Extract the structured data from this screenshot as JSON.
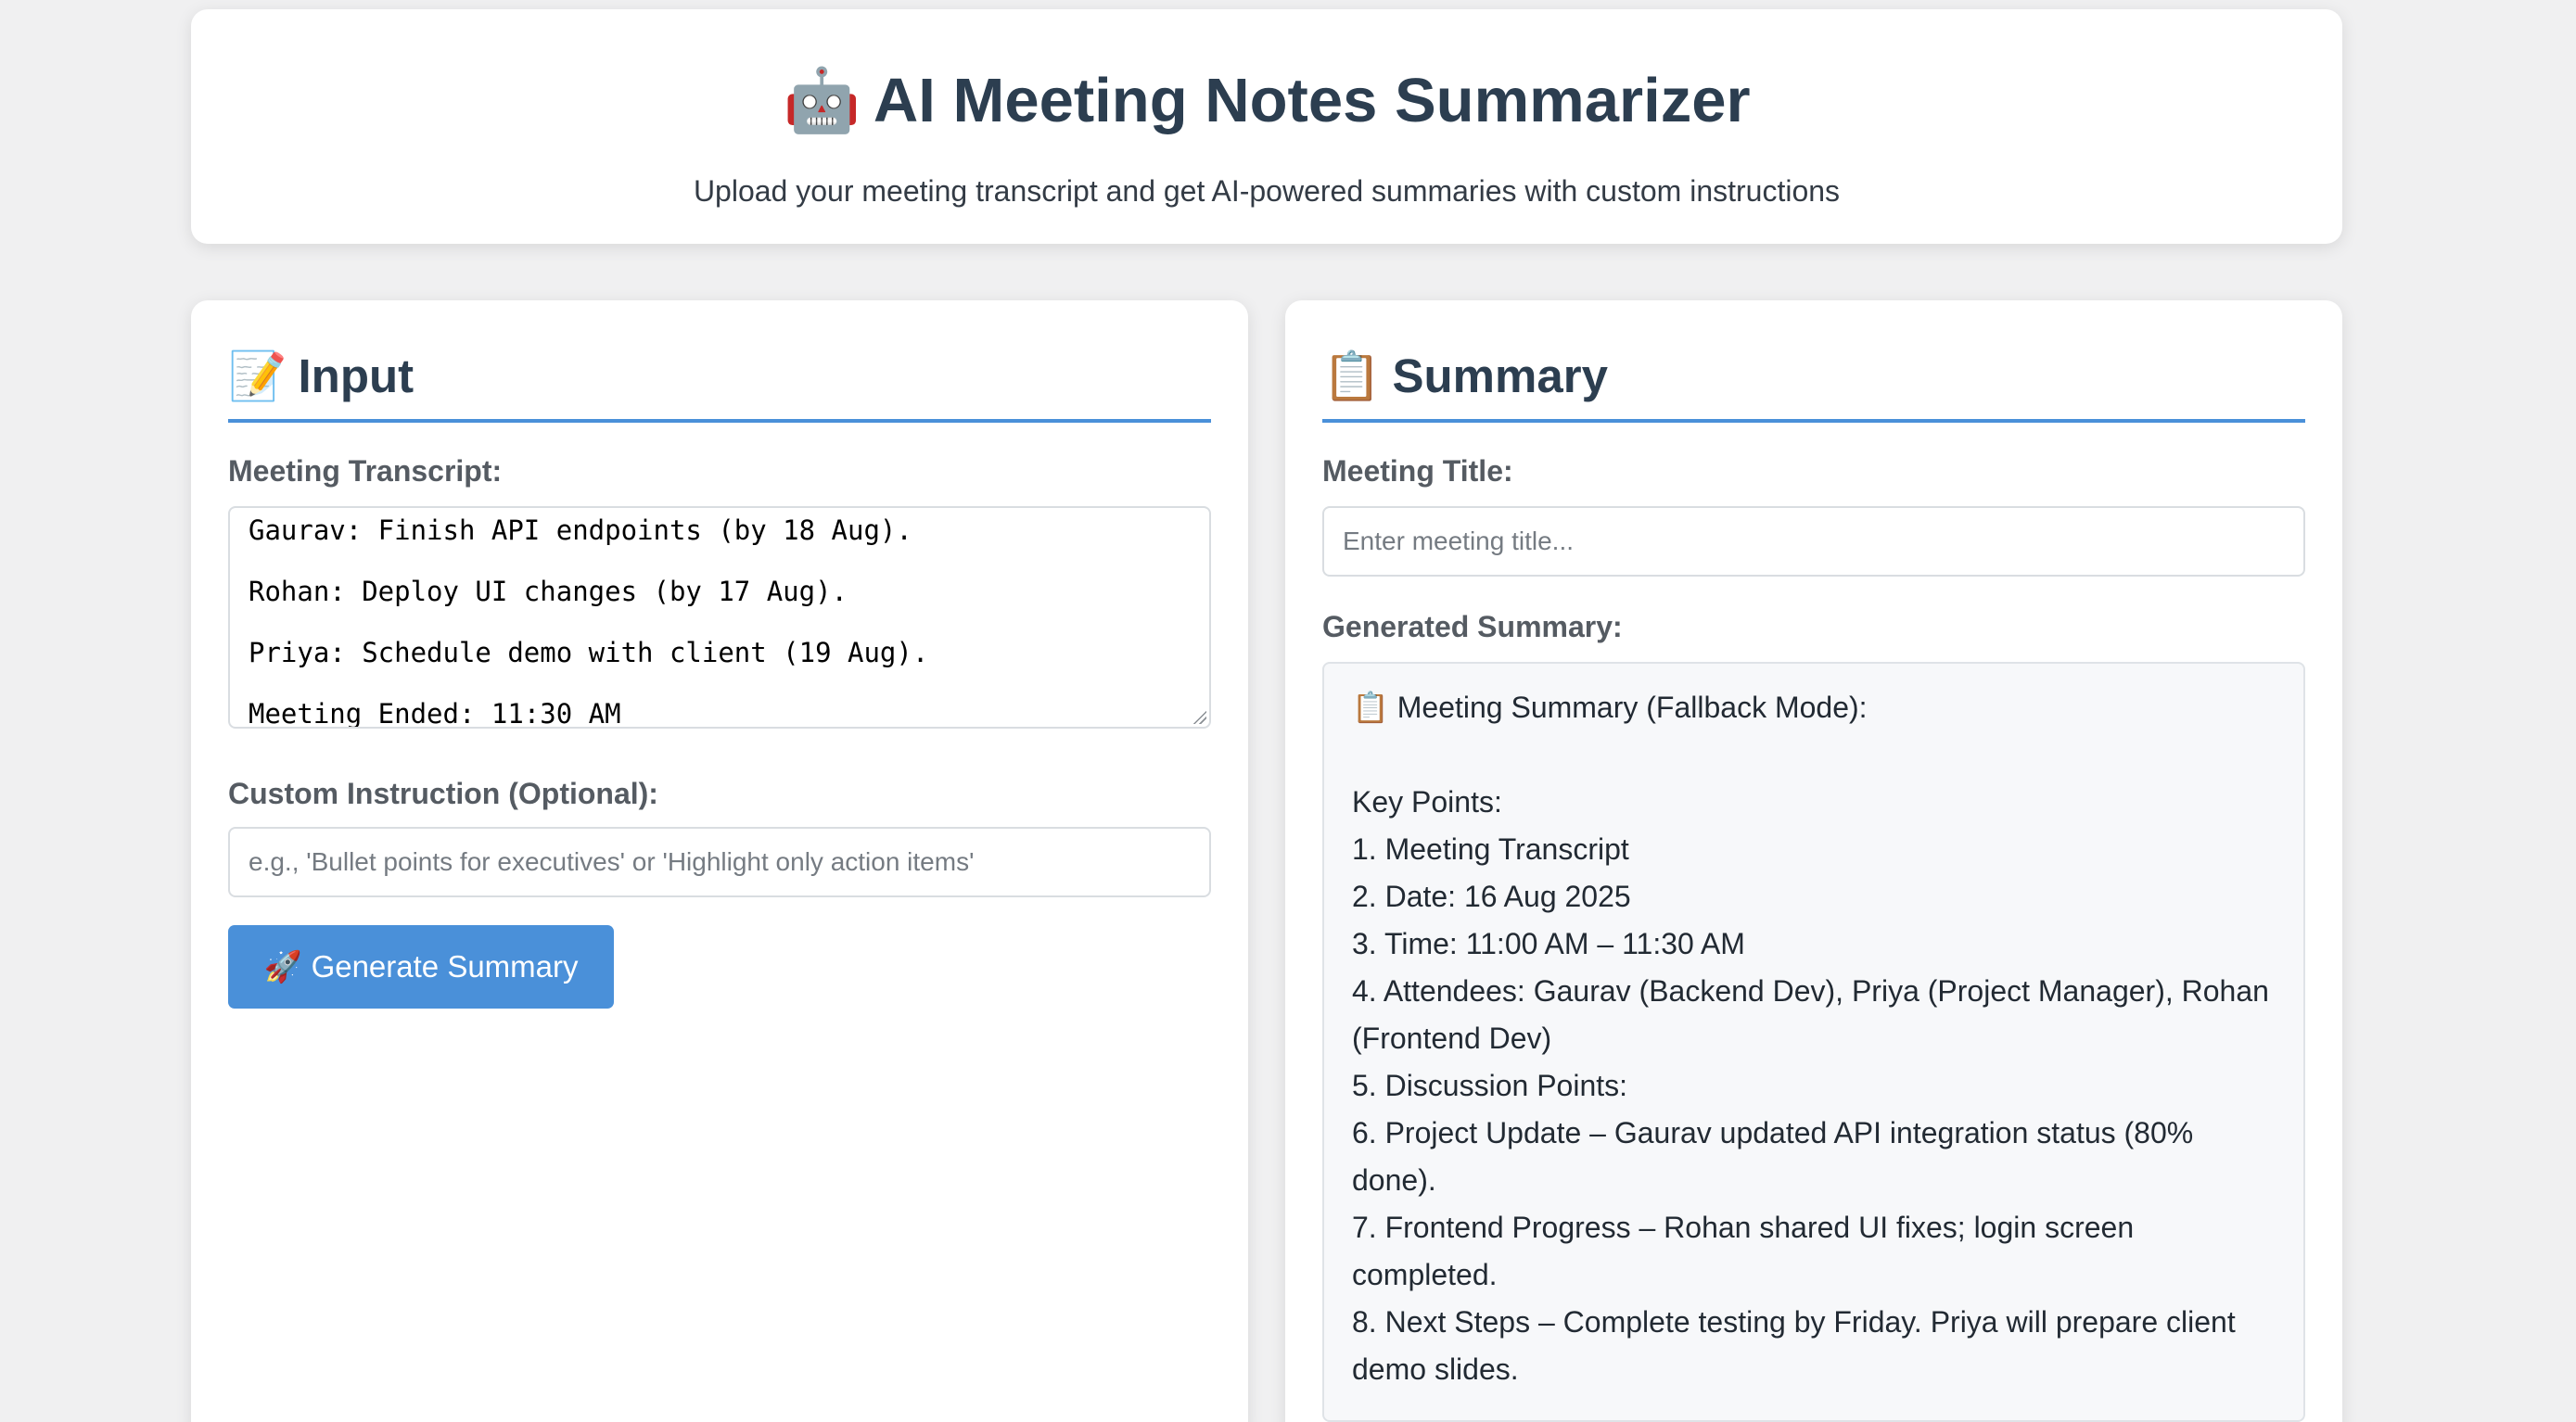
{
  "header": {
    "icon": "robot-icon",
    "icon_glyph": "🤖",
    "title": "AI Meeting Notes Summarizer",
    "subtitle": "Upload your meeting transcript and get AI-powered summaries with custom instructions"
  },
  "input_panel": {
    "icon": "memo-icon",
    "icon_glyph": "📝",
    "heading": "Input",
    "transcript_label": "Meeting Transcript:",
    "transcript_lines": [
      "Gaurav: Finish API endpoints (by 18 Aug).",
      "Rohan: Deploy UI changes (by 17 Aug).",
      "Priya: Schedule demo with client (19 Aug).",
      "Meeting Ended: 11:30 AM"
    ],
    "instruction_label": "Custom Instruction (Optional):",
    "instruction_placeholder": "e.g., 'Bullet points for executives' or 'Highlight only action items'",
    "generate_icon": "rocket-icon",
    "generate_icon_glyph": "🚀",
    "generate_label": "Generate Summary"
  },
  "summary_panel": {
    "icon": "clipboard-icon",
    "icon_glyph": "📋",
    "heading": "Summary",
    "title_label": "Meeting Title:",
    "title_placeholder": "Enter meeting title...",
    "generated_label": "Generated Summary:",
    "summary_lines": [
      "📋 Meeting Summary (Fallback Mode):",
      "",
      "Key Points:",
      "1. Meeting Transcript",
      "2. Date: 16 Aug 2025",
      "3. Time: 11:00 AM – 11:30 AM",
      "4. Attendees: Gaurav (Backend Dev), Priya (Project Manager), Rohan",
      "(Frontend Dev)",
      "5. Discussion Points:",
      "6. Project Update – Gaurav updated API integration status (80%",
      "done).",
      "7. Frontend Progress – Rohan shared UI fixes; login screen",
      "completed.",
      "8. Next Steps – Complete testing by Friday. Priya will prepare client",
      "demo slides."
    ]
  },
  "colors": {
    "accent": "#4a90d9",
    "heading_text": "#2c3e50",
    "page_background": "#f0f0f1"
  }
}
